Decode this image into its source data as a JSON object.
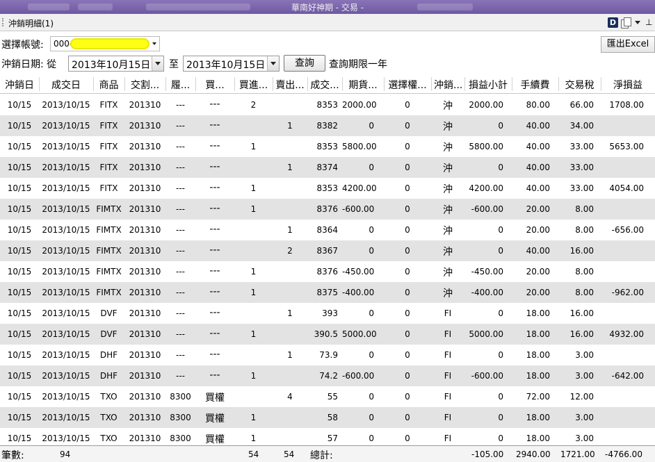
{
  "window": {
    "title": "華南好神期 - 交易 -"
  },
  "panel": {
    "title": "沖銷明細(1)"
  },
  "filters": {
    "account_label": "選擇帳號:",
    "account_value": "000-",
    "export_label": "匯出Excel",
    "date_label": "沖銷日期: 從",
    "date_from": "2013年10月15日",
    "to_label": "至",
    "date_to": "2013年10月15日",
    "query_label": "查詢",
    "limit_note": "查詢期限一年"
  },
  "columns": [
    "沖銷日",
    "成交日",
    "商品",
    "交割...",
    "履...",
    "買...",
    "買進...",
    "賣出...",
    "成交...",
    "期貨...",
    "選擇權...",
    "沖銷...",
    "損益小計",
    "手續費",
    "交易稅",
    "淨損益"
  ],
  "rows": [
    [
      "10/15",
      "2013/10/15",
      "FITX",
      "201310",
      "---",
      "---",
      "2",
      "",
      "8353",
      "2000.00",
      "0",
      "沖",
      "2000.00",
      "80.00",
      "66.00",
      "1708.00"
    ],
    [
      "10/15",
      "2013/10/15",
      "FITX",
      "201310",
      "---",
      "---",
      "",
      "1",
      "8382",
      "0",
      "0",
      "沖",
      "0",
      "40.00",
      "34.00",
      ""
    ],
    [
      "10/15",
      "2013/10/15",
      "FITX",
      "201310",
      "---",
      "---",
      "1",
      "",
      "8353",
      "5800.00",
      "0",
      "沖",
      "5800.00",
      "40.00",
      "33.00",
      "5653.00"
    ],
    [
      "10/15",
      "2013/10/15",
      "FITX",
      "201310",
      "---",
      "---",
      "",
      "1",
      "8374",
      "0",
      "0",
      "沖",
      "0",
      "40.00",
      "33.00",
      ""
    ],
    [
      "10/15",
      "2013/10/15",
      "FITX",
      "201310",
      "---",
      "---",
      "1",
      "",
      "8353",
      "4200.00",
      "0",
      "沖",
      "4200.00",
      "40.00",
      "33.00",
      "4054.00"
    ],
    [
      "10/15",
      "2013/10/15",
      "FIMTX",
      "201310",
      "---",
      "---",
      "1",
      "",
      "8376",
      "-600.00",
      "0",
      "沖",
      "-600.00",
      "20.00",
      "8.00",
      ""
    ],
    [
      "10/15",
      "2013/10/15",
      "FIMTX",
      "201310",
      "---",
      "---",
      "",
      "1",
      "8364",
      "0",
      "0",
      "沖",
      "0",
      "20.00",
      "8.00",
      "-656.00"
    ],
    [
      "10/15",
      "2013/10/15",
      "FIMTX",
      "201310",
      "---",
      "---",
      "",
      "2",
      "8367",
      "0",
      "0",
      "沖",
      "0",
      "40.00",
      "16.00",
      ""
    ],
    [
      "10/15",
      "2013/10/15",
      "FIMTX",
      "201310",
      "---",
      "---",
      "1",
      "",
      "8376",
      "-450.00",
      "0",
      "沖",
      "-450.00",
      "20.00",
      "8.00",
      ""
    ],
    [
      "10/15",
      "2013/10/15",
      "FIMTX",
      "201310",
      "---",
      "---",
      "1",
      "",
      "8375",
      "-400.00",
      "0",
      "沖",
      "-400.00",
      "20.00",
      "8.00",
      "-962.00"
    ],
    [
      "10/15",
      "2013/10/15",
      "DVF",
      "201310",
      "---",
      "---",
      "",
      "1",
      "393",
      "0",
      "0",
      "FI",
      "0",
      "18.00",
      "16.00",
      ""
    ],
    [
      "10/15",
      "2013/10/15",
      "DVF",
      "201310",
      "---",
      "---",
      "1",
      "",
      "390.5",
      "5000.00",
      "0",
      "FI",
      "5000.00",
      "18.00",
      "16.00",
      "4932.00"
    ],
    [
      "10/15",
      "2013/10/15",
      "DHF",
      "201310",
      "---",
      "---",
      "",
      "1",
      "73.9",
      "0",
      "0",
      "FI",
      "0",
      "18.00",
      "3.00",
      ""
    ],
    [
      "10/15",
      "2013/10/15",
      "DHF",
      "201310",
      "---",
      "---",
      "1",
      "",
      "74.2",
      "-600.00",
      "0",
      "FI",
      "-600.00",
      "18.00",
      "3.00",
      "-642.00"
    ],
    [
      "10/15",
      "2013/10/15",
      "TXO",
      "201310",
      "8300",
      "買權",
      "",
      "4",
      "55",
      "0",
      "0",
      "FI",
      "0",
      "72.00",
      "12.00",
      ""
    ],
    [
      "10/15",
      "2013/10/15",
      "TXO",
      "201310",
      "8300",
      "買權",
      "1",
      "",
      "58",
      "0",
      "0",
      "FI",
      "0",
      "18.00",
      "3.00",
      ""
    ],
    [
      "10/15",
      "2013/10/15",
      "TXO",
      "201310",
      "8300",
      "買權",
      "1",
      "",
      "57",
      "0",
      "0",
      "FI",
      "0",
      "18.00",
      "3.00",
      ""
    ]
  ],
  "footer": {
    "count_label": "筆數:",
    "count_value": "94",
    "buy_total": "54",
    "sell_total": "54",
    "total_label": "總計:",
    "pl_total": "-105.00",
    "fee_total": "2940.00",
    "tax_total": "1721.00",
    "net_total": "-4766.00"
  }
}
